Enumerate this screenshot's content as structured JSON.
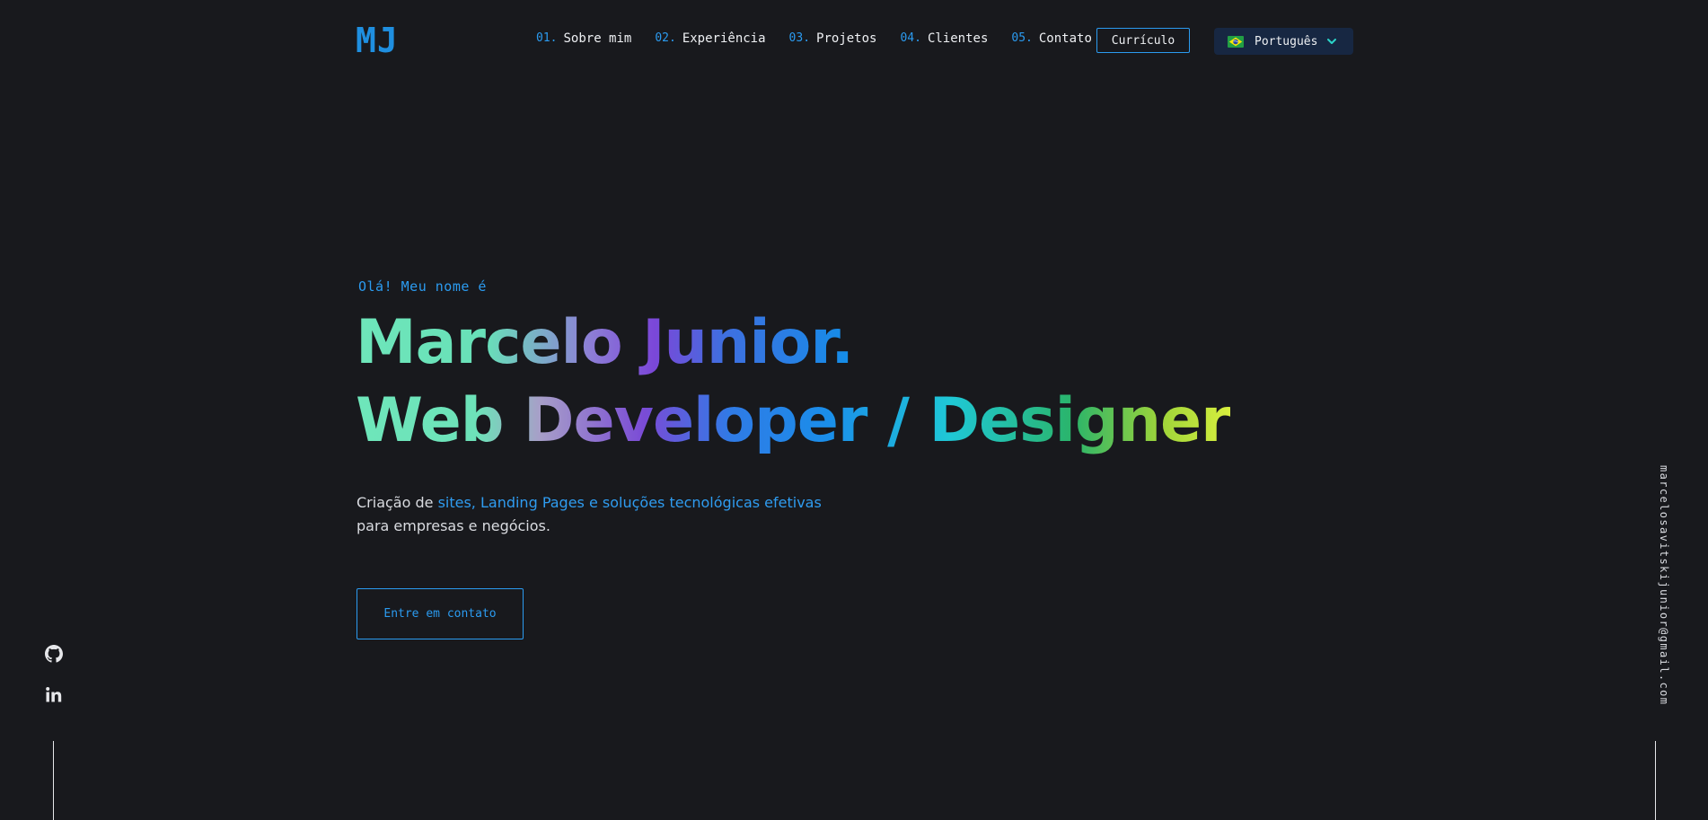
{
  "header": {
    "logo": "MJ",
    "nav": [
      {
        "num": "01.",
        "label": "Sobre mim"
      },
      {
        "num": "02.",
        "label": "Experiência"
      },
      {
        "num": "03.",
        "label": "Projetos"
      },
      {
        "num": "04.",
        "label": "Clientes"
      },
      {
        "num": "05.",
        "label": "Contato"
      }
    ],
    "resume_label": "Currículo",
    "language": {
      "selected": "Português",
      "flag_icon": "brazil-flag-icon",
      "chevron_icon": "chevron-down-icon"
    }
  },
  "hero": {
    "greeting": "Olá! Meu nome é",
    "name": "Marcelo Junior.",
    "role": "Web Developer / Designer",
    "description": {
      "prefix": "Criação de ",
      "highlight": "sites, Landing Pages e soluções tecnológicas efetivas",
      "suffix": "para empresas e negócios."
    },
    "cta_label": "Entre em contato"
  },
  "social": {
    "icons": [
      "github-icon",
      "linkedin-icon"
    ]
  },
  "email": "marcelosavitskijunior@gmail.com",
  "colors": {
    "background": "#18191d",
    "accent": "#2b9bf0",
    "text": "#e6e7ea",
    "language_bg": "#172742"
  }
}
